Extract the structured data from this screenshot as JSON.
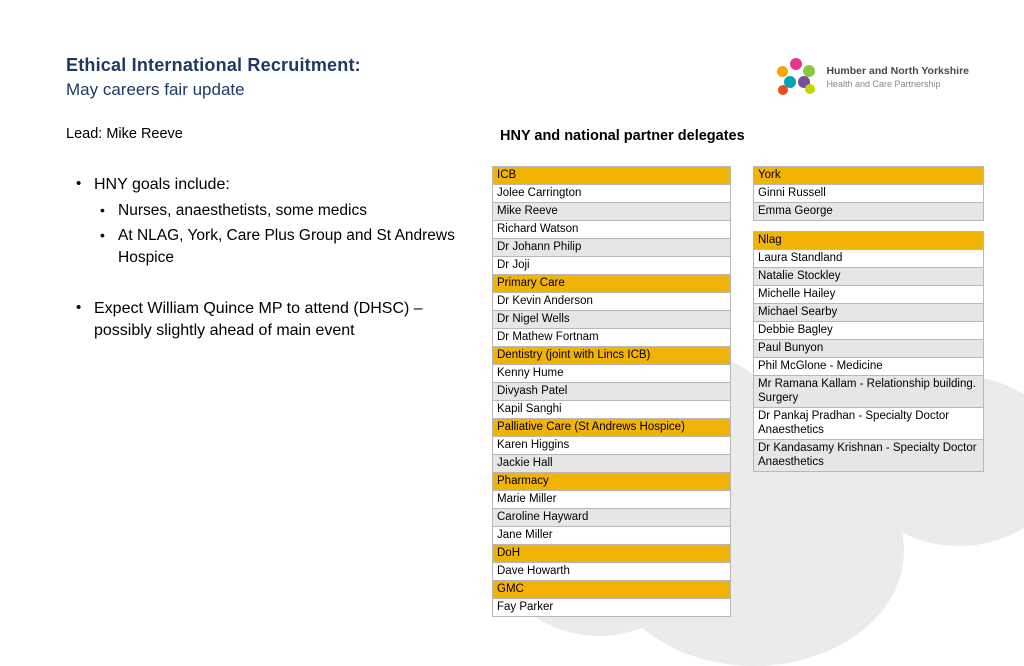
{
  "slide": {
    "title_line1": "Ethical International Recruitment:",
    "title_line2": "May careers fair update",
    "lead": "Lead: Mike Reeve",
    "bullets": [
      {
        "level": 1,
        "text": "HNY goals include:"
      },
      {
        "level": 2,
        "text": "Nurses, anaesthetists, some medics"
      },
      {
        "level": 2,
        "text": "At NLAG, York, Care Plus Group and St Andrews Hospice"
      },
      {
        "level": 1,
        "text": "Expect William Quince MP to attend (DHSC) – possibly slightly ahead of main event"
      }
    ],
    "delegates_heading": "HNY and national partner delegates"
  },
  "logo": {
    "line1": "Humber and North Yorkshire",
    "line2": "Health and Care Partnership",
    "colors": [
      "#e8368f",
      "#f7a600",
      "#8cc63f",
      "#00a5b5",
      "#7b4b9c",
      "#e94e1b",
      "#c8d400"
    ]
  },
  "left_table": [
    {
      "type": "header",
      "text": "ICB"
    },
    {
      "type": "plain",
      "text": "Jolee Carrington"
    },
    {
      "type": "alt",
      "text": "Mike Reeve"
    },
    {
      "type": "plain",
      "text": "Richard Watson"
    },
    {
      "type": "alt",
      "text": "Dr Johann Philip"
    },
    {
      "type": "plain",
      "text": "Dr Joji"
    },
    {
      "type": "header",
      "text": "Primary Care"
    },
    {
      "type": "plain",
      "text": "Dr Kevin Anderson"
    },
    {
      "type": "alt",
      "text": "Dr Nigel Wells"
    },
    {
      "type": "plain",
      "text": "Dr Mathew Fortnam"
    },
    {
      "type": "header",
      "text": "Dentistry (joint with Lincs ICB)"
    },
    {
      "type": "plain",
      "text": "Kenny Hume"
    },
    {
      "type": "alt",
      "text": "Divyash Patel"
    },
    {
      "type": "plain",
      "text": "Kapil Sanghi"
    },
    {
      "type": "header",
      "text": "Palliative Care (St Andrews Hospice)"
    },
    {
      "type": "plain",
      "text": "Karen Higgins"
    },
    {
      "type": "alt",
      "text": "Jackie Hall"
    },
    {
      "type": "header",
      "text": "Pharmacy"
    },
    {
      "type": "plain",
      "text": "Marie Miller"
    },
    {
      "type": "alt",
      "text": "Caroline Hayward"
    },
    {
      "type": "plain",
      "text": "Jane Miller"
    },
    {
      "type": "header",
      "text": "DoH"
    },
    {
      "type": "plain",
      "text": "Dave Howarth"
    },
    {
      "type": "header",
      "text": "GMC"
    },
    {
      "type": "plain",
      "text": "Fay Parker"
    }
  ],
  "right_table_top": [
    {
      "type": "header",
      "text": "York"
    },
    {
      "type": "plain",
      "text": "Ginni Russell"
    },
    {
      "type": "alt",
      "text": "Emma George"
    }
  ],
  "right_table_bottom": [
    {
      "type": "header",
      "text": "Nlag"
    },
    {
      "type": "plain",
      "text": "Laura Standland"
    },
    {
      "type": "alt",
      "text": "Natalie Stockley"
    },
    {
      "type": "plain",
      "text": "Michelle Hailey"
    },
    {
      "type": "alt",
      "text": "Michael Searby"
    },
    {
      "type": "plain",
      "text": "Debbie Bagley"
    },
    {
      "type": "alt",
      "text": "Paul Bunyon"
    },
    {
      "type": "plain",
      "text": "Phil McGlone - Medicine"
    },
    {
      "type": "alt",
      "text": "Mr Ramana Kallam - Relationship building. Surgery"
    },
    {
      "type": "plain",
      "text": "Dr Pankaj Pradhan - Specialty Doctor Anaesthetics"
    },
    {
      "type": "alt",
      "text": "Dr Kandasamy Krishnan - Specialty Doctor Anaesthetics"
    }
  ]
}
